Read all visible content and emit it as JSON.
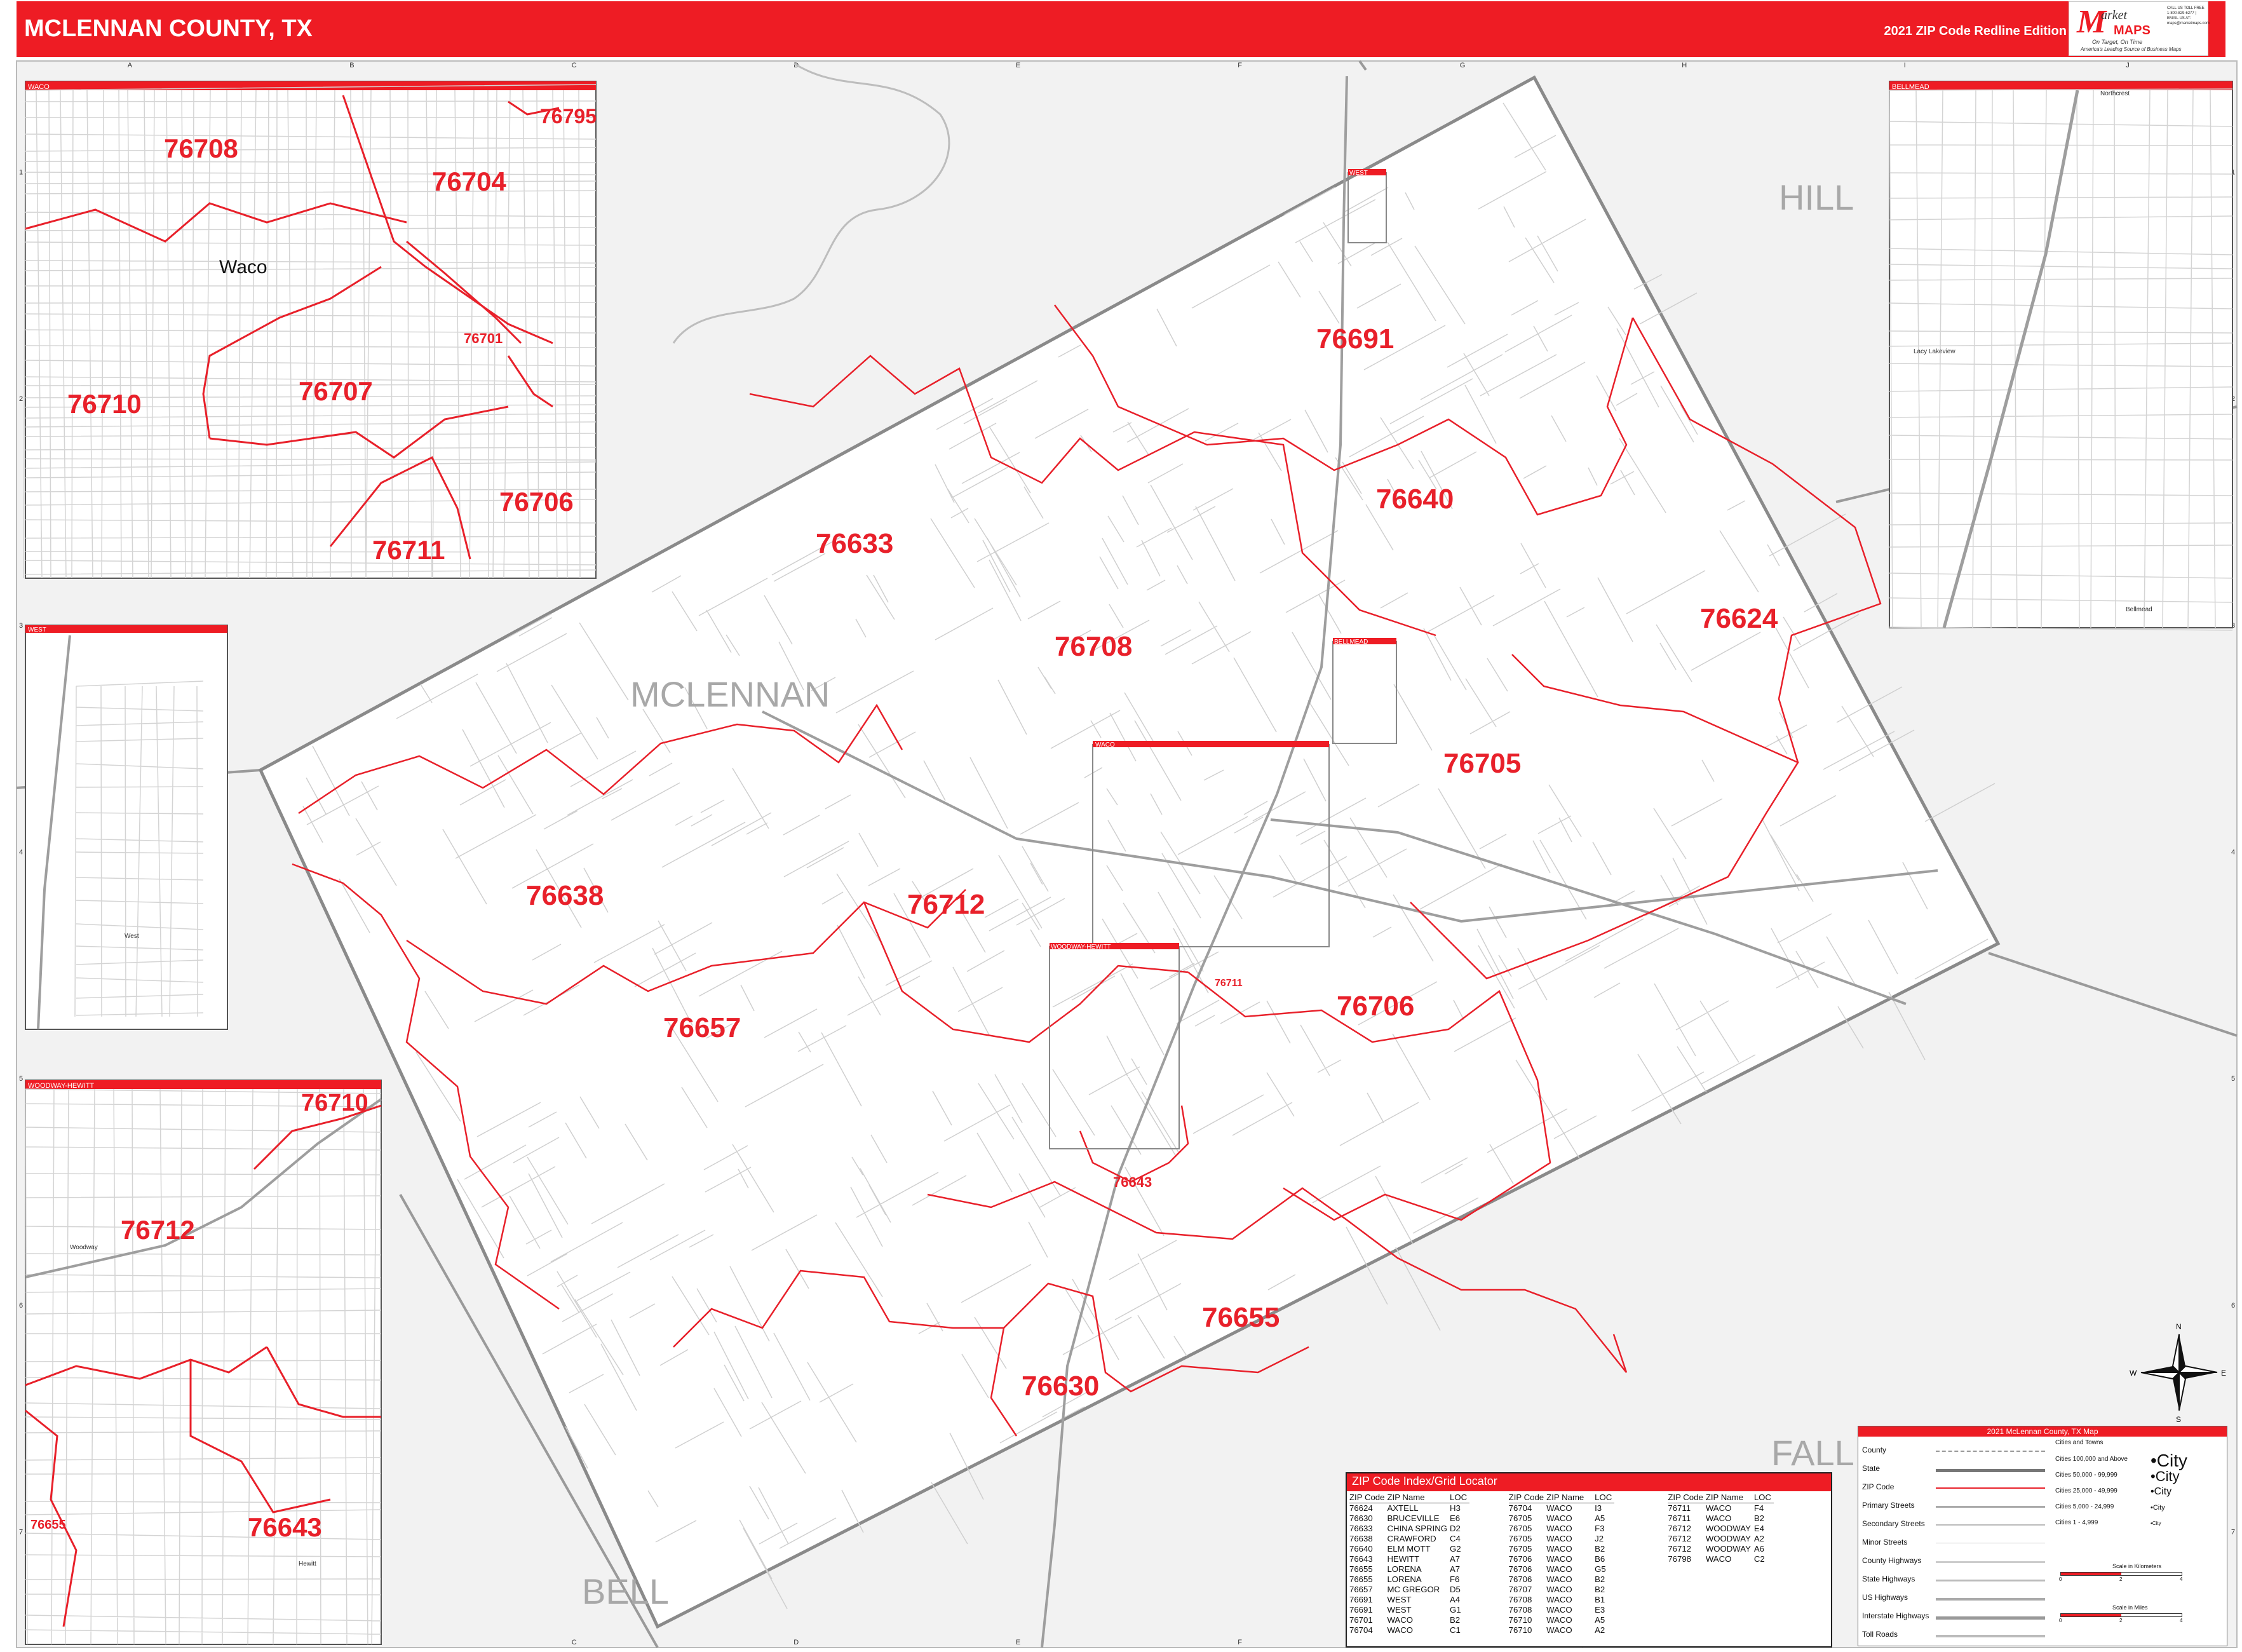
{
  "header": {
    "title": "MCLENNAN COUNTY, TX",
    "edition": "2021 ZIP Code Redline Edition"
  },
  "logo": {
    "brand_m": "M",
    "brand_top": "arket",
    "brand_bottom": "MAPS",
    "tagline": "On Target, On Time",
    "tagline2": "America's Leading Source of Business Maps",
    "side_text": "CALL US TOLL FREE 1-800-829-6277 | EMAIL US AT: maps@marketmaps.com"
  },
  "grid": {
    "columns": [
      "A",
      "B",
      "C",
      "D",
      "E",
      "F",
      "G",
      "H",
      "I",
      "J"
    ],
    "rows": [
      "1",
      "2",
      "3",
      "4",
      "5",
      "6",
      "7"
    ]
  },
  "regions": {
    "county": "MCLENNAN",
    "hill": "HILL",
    "bell": "BELL",
    "falls": "FALL"
  },
  "main_zips": [
    {
      "code": "76691"
    },
    {
      "code": "76640"
    },
    {
      "code": "76633"
    },
    {
      "code": "76624"
    },
    {
      "code": "76708"
    },
    {
      "code": "76705"
    },
    {
      "code": "76638"
    },
    {
      "code": "76712"
    },
    {
      "code": "76657"
    },
    {
      "code": "76706"
    },
    {
      "code": "76711"
    },
    {
      "code": "76643"
    },
    {
      "code": "76655"
    },
    {
      "code": "76630"
    }
  ],
  "insets": {
    "waco": {
      "title": "WACO",
      "city": "Waco",
      "zips": [
        "76708",
        "76704",
        "76795",
        "76710",
        "76707",
        "76701",
        "76706",
        "76711"
      ]
    },
    "west": {
      "title": "WEST",
      "place": "West"
    },
    "woodway": {
      "title": "WOODWAY-HEWITT",
      "zips": [
        "76710",
        "76712",
        "76643",
        "76655"
      ],
      "places": [
        "Woodway",
        "Hewitt"
      ]
    },
    "bellmead": {
      "title": "BELLMEAD",
      "places": [
        "Northcrest",
        "Lacy Lakeview",
        "Bellmead"
      ]
    }
  },
  "inset_markers": [
    "WEST",
    "BELLMEAD",
    "WACO",
    "WOODWAY-HEWITT"
  ],
  "compass": {
    "n": "N",
    "s": "S",
    "e": "E",
    "w": "W"
  },
  "zip_index": {
    "title": "ZIP Code Index/Grid Locator",
    "headers": [
      "ZIP Code",
      "ZIP Name",
      "LOC"
    ],
    "rows": [
      [
        "76624",
        "AXTELL",
        "H3"
      ],
      [
        "76630",
        "BRUCEVILLE",
        "E6"
      ],
      [
        "76633",
        "CHINA SPRING",
        "D2"
      ],
      [
        "76638",
        "CRAWFORD",
        "C4"
      ],
      [
        "76640",
        "ELM MOTT",
        "G2"
      ],
      [
        "76643",
        "HEWITT",
        "A7"
      ],
      [
        "76655",
        "LORENA",
        "A7"
      ],
      [
        "76655",
        "LORENA",
        "F6"
      ],
      [
        "76657",
        "MC GREGOR",
        "D5"
      ],
      [
        "76691",
        "WEST",
        "A4"
      ],
      [
        "76691",
        "WEST",
        "G1"
      ],
      [
        "76701",
        "WACO",
        "B2"
      ],
      [
        "76704",
        "WACO",
        "C1"
      ],
      [
        "76704",
        "WACO",
        "I3"
      ],
      [
        "76705",
        "WACO",
        "A5"
      ],
      [
        "76705",
        "WACO",
        "F3"
      ],
      [
        "76705",
        "WACO",
        "J2"
      ],
      [
        "76705",
        "WACO",
        "B2"
      ],
      [
        "76706",
        "WACO",
        "B6"
      ],
      [
        "76706",
        "WACO",
        "G5"
      ],
      [
        "76706",
        "WACO",
        "B2"
      ],
      [
        "76707",
        "WACO",
        "B2"
      ],
      [
        "76708",
        "WACO",
        "B1"
      ],
      [
        "76708",
        "WACO",
        "E3"
      ],
      [
        "76710",
        "WACO",
        "A5"
      ],
      [
        "76710",
        "WACO",
        "A2"
      ],
      [
        "76711",
        "WACO",
        "F4"
      ],
      [
        "76711",
        "WACO",
        "B2"
      ],
      [
        "76712",
        "WOODWAY",
        "E4"
      ],
      [
        "76712",
        "WOODWAY",
        "A2"
      ],
      [
        "76712",
        "WOODWAY",
        "A6"
      ],
      [
        "76798",
        "WACO",
        "C2"
      ]
    ]
  },
  "legend": {
    "title": "2021 McLennan County, TX Map",
    "items": [
      "County",
      "State",
      "ZIP Code",
      "Primary Streets",
      "Secondary Streets",
      "Minor Streets",
      "County Highways",
      "State Highways",
      "US Highways",
      "Interstate Highways",
      "Toll Roads"
    ],
    "cities_header": "Cities and Towns",
    "city_ranges": [
      "Cities 100,000 and Above",
      "Cities 50,000 - 99,999",
      "Cities 25,000 - 49,999",
      "Cities 5,000 - 24,999",
      "Cities 1 - 4,999"
    ],
    "city_samples": [
      "City",
      "City",
      "City",
      "City",
      "City"
    ],
    "scale_km": "Scale in Kilometers",
    "scale_mi": "Scale in Miles",
    "scale_ticks": [
      "0",
      "2",
      "4"
    ]
  },
  "colors": {
    "accent": "#ee1c24",
    "zip_boundary": "#e8202a",
    "county_line": "#888888",
    "outside_fill": "#f2f2f2"
  }
}
